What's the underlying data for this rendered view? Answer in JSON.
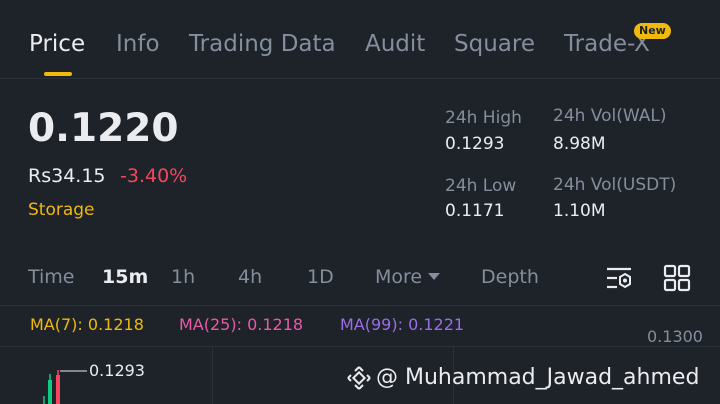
{
  "tabs": [
    {
      "label": "Price",
      "active": true
    },
    {
      "label": "Info"
    },
    {
      "label": "Trading Data"
    },
    {
      "label": "Audit"
    },
    {
      "label": "Square"
    },
    {
      "label": "Trade-X",
      "badge": "New"
    }
  ],
  "ticker": {
    "price": "0.1220",
    "fiat_price": "Rs34.15",
    "change": "-3.40%",
    "tag": "Storage"
  },
  "stats": {
    "high_label": "24h High",
    "high_value": "0.1293",
    "vol_base_label": "24h Vol(WAL)",
    "vol_base_value": "8.98M",
    "low_label": "24h Low",
    "low_value": "0.1171",
    "vol_quote_label": "24h Vol(USDT)",
    "vol_quote_value": "1.10M"
  },
  "timeframes": {
    "time": "Time",
    "m15": "15m",
    "h1": "1h",
    "h4": "4h",
    "d1": "1D",
    "more": "More",
    "depth": "Depth",
    "active": "15m"
  },
  "indicators": {
    "ma7": "MA(7): 0.1218",
    "ma25": "MA(25): 0.1218",
    "ma99": "MA(99): 0.1221"
  },
  "chart": {
    "axis_top": "0.1300",
    "high_marker": "0.1293"
  },
  "watermark": "@ Muhammad_Jawad_ahmed",
  "colors": {
    "background": "#1e2329",
    "accent": "#f0b90b",
    "down": "#f6465d",
    "up": "#0ecb81",
    "ma7": "#f0b90b",
    "ma25": "#e85aa8",
    "ma99": "#9a6ee8"
  },
  "icons": [
    "chart-settings-icon",
    "grid-layout-icon",
    "binance-logo-icon",
    "chevron-down-icon"
  ]
}
